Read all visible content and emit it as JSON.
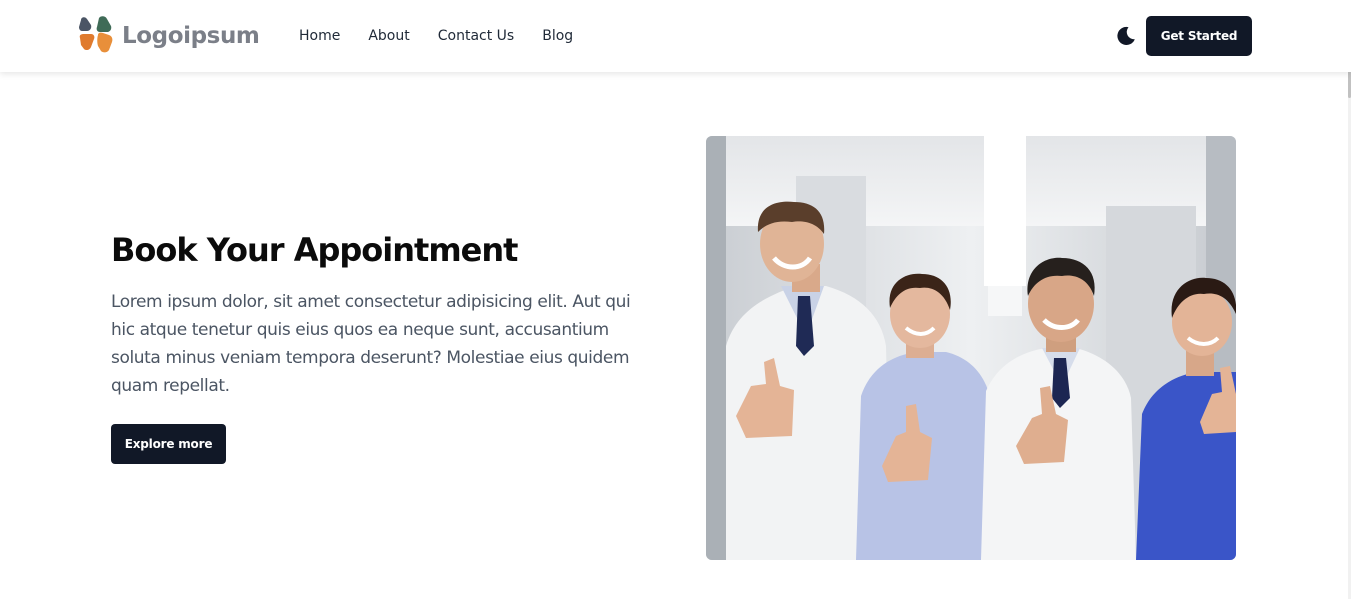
{
  "header": {
    "logo_text": "Logoipsum",
    "nav": [
      {
        "label": "Home"
      },
      {
        "label": "About"
      },
      {
        "label": "Contact Us"
      },
      {
        "label": "Blog"
      }
    ],
    "theme_icon": "moon-icon",
    "cta_label": "Get Started"
  },
  "hero": {
    "title": "Book Your Appointment",
    "description": "Lorem ipsum dolor, sit amet consectetur adipisicing elit. Aut qui hic atque tenetur quis eius quos ea neque sunt, accusantium soluta minus veniam tempora deserunt? Molestiae eius quidem quam repellat.",
    "button_label": "Explore more"
  },
  "colors": {
    "primary_dark": "#111827",
    "logo_text": "#7b7f88",
    "logo_green": "#3f6b57",
    "logo_orange": "#e07b2e",
    "logo_slate": "#4b5565",
    "body_text": "#4b5563"
  }
}
